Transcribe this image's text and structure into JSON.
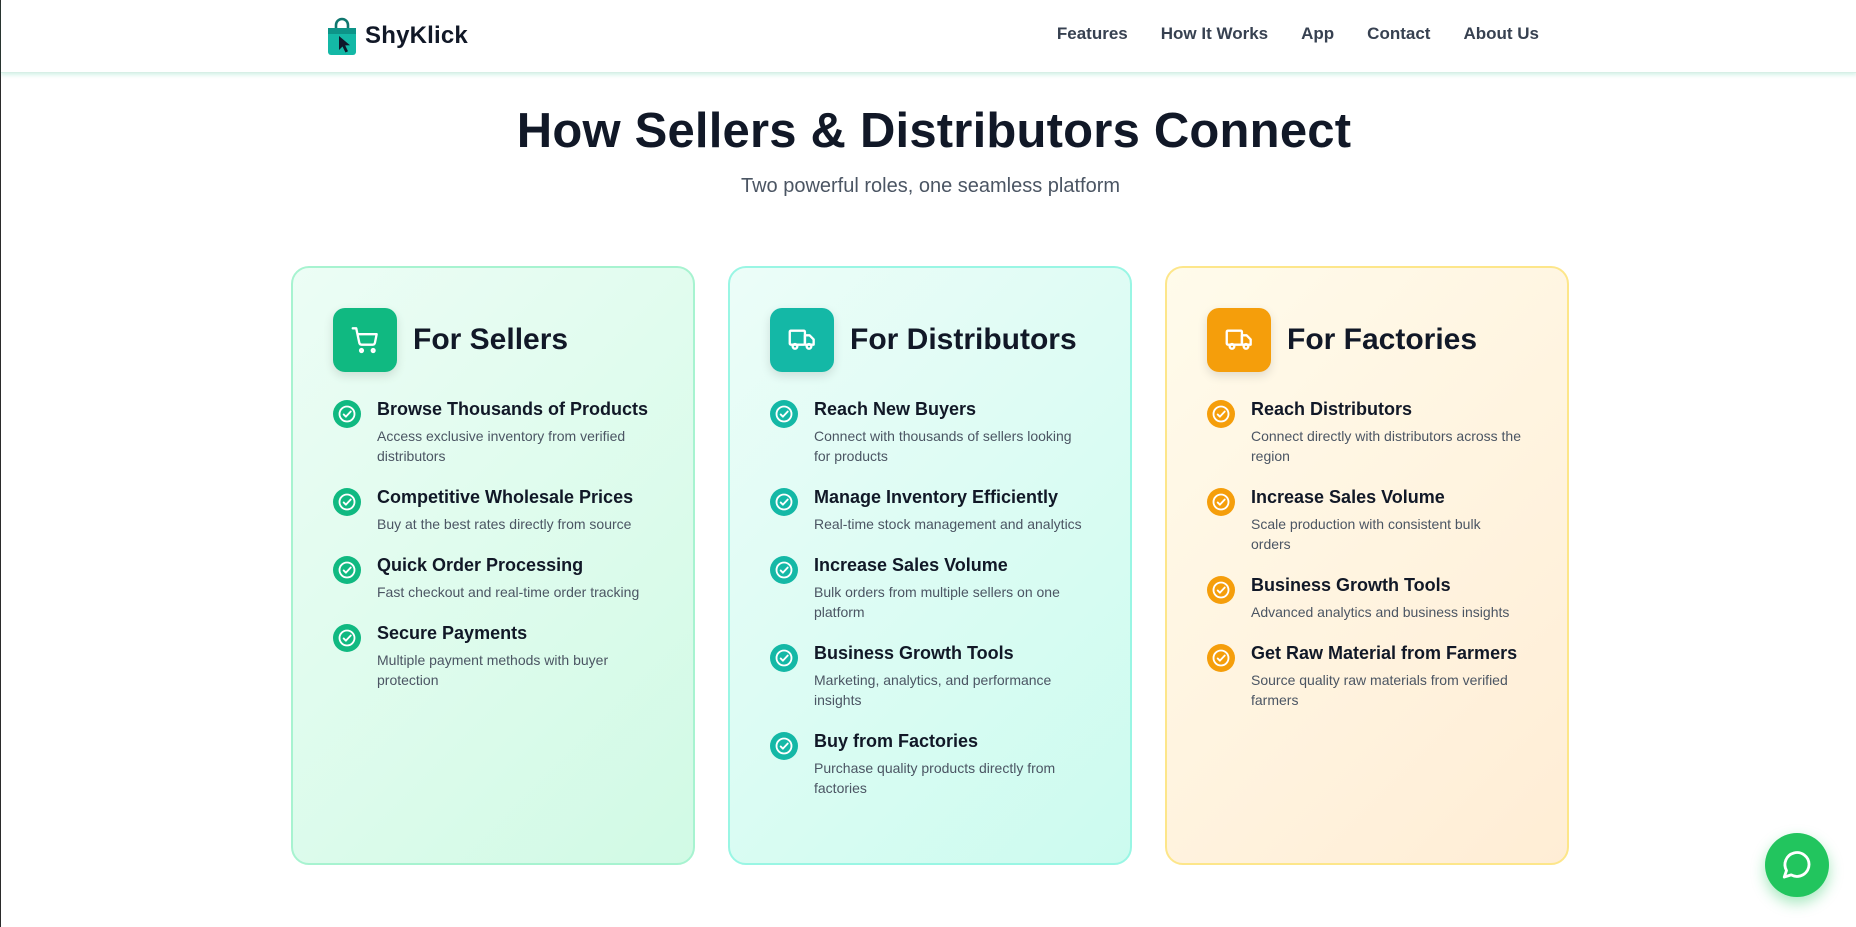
{
  "brand": {
    "name": "ShyKlick",
    "icon": "shopping-bag-cursor-icon"
  },
  "nav": {
    "links": [
      "Features",
      "How It Works",
      "App",
      "Contact",
      "About Us"
    ]
  },
  "hero": {
    "title": "How Sellers & Distributors Connect",
    "subtitle": "Two powerful roles, one seamless platform"
  },
  "cards": [
    {
      "title": "For Sellers",
      "icon": "cart-icon",
      "accent": "#10b981",
      "features": [
        {
          "title": "Browse Thousands of Products",
          "desc": "Access exclusive inventory from verified distributors"
        },
        {
          "title": "Competitive Wholesale Prices",
          "desc": "Buy at the best rates directly from source"
        },
        {
          "title": "Quick Order Processing",
          "desc": "Fast checkout and real-time order tracking"
        },
        {
          "title": "Secure Payments",
          "desc": "Multiple payment methods with buyer protection"
        }
      ]
    },
    {
      "title": "For Distributors",
      "icon": "truck-icon",
      "accent": "#14b8a6",
      "features": [
        {
          "title": "Reach New Buyers",
          "desc": "Connect with thousands of sellers looking for products"
        },
        {
          "title": "Manage Inventory Efficiently",
          "desc": "Real-time stock management and analytics"
        },
        {
          "title": "Increase Sales Volume",
          "desc": "Bulk orders from multiple sellers on one platform"
        },
        {
          "title": "Business Growth Tools",
          "desc": "Marketing, analytics, and performance insights"
        },
        {
          "title": "Buy from Factories",
          "desc": "Purchase quality products directly from factories"
        }
      ]
    },
    {
      "title": "For Factories",
      "icon": "truck-icon",
      "accent": "#f59e0b",
      "features": [
        {
          "title": "Reach Distributors",
          "desc": "Connect directly with distributors across the region"
        },
        {
          "title": "Increase Sales Volume",
          "desc": "Scale production with consistent bulk orders"
        },
        {
          "title": "Business Growth Tools",
          "desc": "Advanced analytics and business insights"
        },
        {
          "title": "Get Raw Material from Farmers",
          "desc": "Source quality raw materials from verified farmers"
        }
      ]
    }
  ],
  "chat": {
    "icon": "chat-bubble-icon",
    "color": "#22c55e"
  }
}
